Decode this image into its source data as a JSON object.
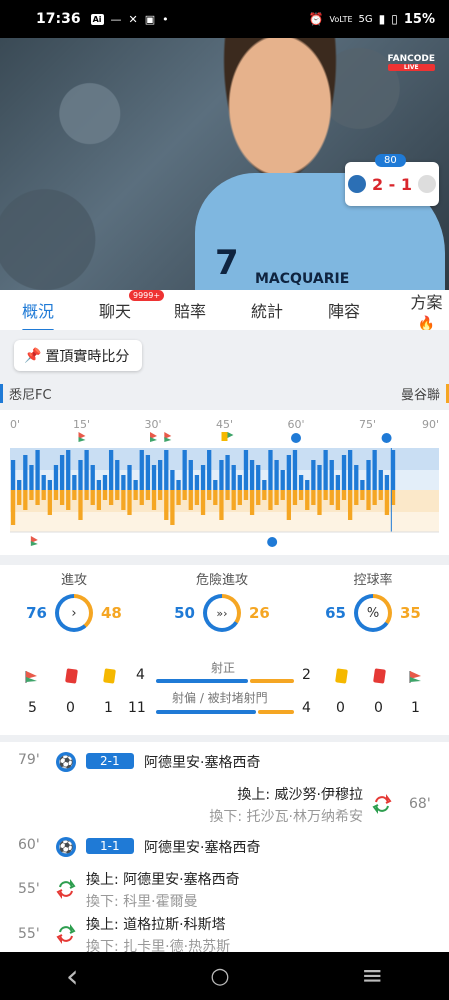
{
  "status": {
    "time": "17:36",
    "icons": [
      "ai-icon",
      "dash-icon",
      "x-icon",
      "cast-icon",
      "dot-icon"
    ],
    "network": "5G",
    "battery": "15%"
  },
  "video": {
    "jersey_number": "7",
    "sponsor": "MACQUARIE",
    "broadcaster": "FANCODE",
    "live_label": "LIVE",
    "score_popup": {
      "minute": "80",
      "score": "2 - 1"
    }
  },
  "tabs": [
    {
      "label": "概況",
      "active": true
    },
    {
      "label": "聊天",
      "badge": "9999+"
    },
    {
      "label": "賠率"
    },
    {
      "label": "統計"
    },
    {
      "label": "陣容"
    },
    {
      "label": "方案"
    }
  ],
  "pin_button": "置頂實時比分",
  "teams": {
    "home": "悉尼FC",
    "away": "曼谷聯"
  },
  "timeline": {
    "ticks": [
      "0'",
      "15'",
      "30'",
      "45'",
      "60'",
      "75'",
      "90'"
    ],
    "home_pressure": [
      6,
      2,
      7,
      5,
      8,
      3,
      2,
      5,
      7,
      8,
      3,
      6,
      8,
      5,
      2,
      3,
      8,
      6,
      3,
      5,
      2,
      8,
      7,
      5,
      6,
      8,
      4,
      2,
      8,
      6,
      3,
      5,
      8,
      2,
      6,
      7,
      5,
      3,
      8,
      6,
      5,
      2,
      8,
      6,
      4,
      7,
      8,
      3,
      2,
      6,
      5,
      8,
      6,
      3,
      7,
      8,
      5,
      2,
      6,
      8,
      4,
      3,
      8,
      5,
      6,
      2,
      8,
      7,
      5,
      3
    ],
    "away_pressure": [
      7,
      3,
      4,
      2,
      3,
      2,
      5,
      2,
      3,
      4,
      2,
      6,
      2,
      3,
      4,
      2,
      3,
      2,
      4,
      5,
      2,
      3,
      2,
      4,
      2,
      6,
      7,
      3,
      2,
      4,
      3,
      5,
      2,
      3,
      6,
      2,
      4,
      3,
      2,
      5,
      3,
      2,
      4,
      3,
      2,
      6,
      3,
      2,
      4,
      3,
      5,
      2,
      3,
      4,
      2,
      6,
      3,
      2,
      4,
      3,
      2,
      5,
      3,
      4,
      2,
      3,
      6,
      2,
      4,
      3
    ],
    "current_minute": 80
  },
  "stats": {
    "attack": {
      "label": "進攻",
      "home": "76",
      "away": "48"
    },
    "dangerous_attack": {
      "label": "危險進攻",
      "home": "50",
      "away": "26"
    },
    "possession": {
      "label": "控球率",
      "home": "65",
      "away": "35",
      "symbol": "%"
    },
    "shots_on_label": "射正",
    "shots_off_label": "射偏 / 被封堵射門",
    "home": {
      "corners": "5",
      "red": "0",
      "yellow": "1",
      "shots_on": "4",
      "shots_off": "11"
    },
    "away": {
      "corners": "1",
      "red": "0",
      "yellow": "0",
      "shots_on": "2",
      "shots_off": "4"
    },
    "colors": {
      "home": "#1f7ad6",
      "away": "#f5a623"
    }
  },
  "events": [
    {
      "minute": "79'",
      "type": "goal",
      "score": "2-1",
      "player": "阿德里安·塞格西奇"
    },
    {
      "minute": "68'",
      "type": "sub",
      "side": "away",
      "on": "換上: 威沙努·伊穆拉",
      "off": "換下: 托沙瓦·林万纳希安"
    },
    {
      "minute": "60'",
      "type": "goal",
      "score": "1-1",
      "player": "阿德里安·塞格西奇"
    },
    {
      "minute": "55'",
      "type": "sub",
      "side": "home",
      "on": "換上: 阿德里安·塞格西奇",
      "off": "換下: 科里·霍爾曼"
    },
    {
      "minute": "55'",
      "type": "sub",
      "side": "home",
      "on": "換上: 道格拉斯·科斯塔",
      "off": "換下: 扎卡里·德·热苏斯"
    }
  ],
  "nav": {
    "back": "‹",
    "home": "○",
    "menu": "≡"
  }
}
